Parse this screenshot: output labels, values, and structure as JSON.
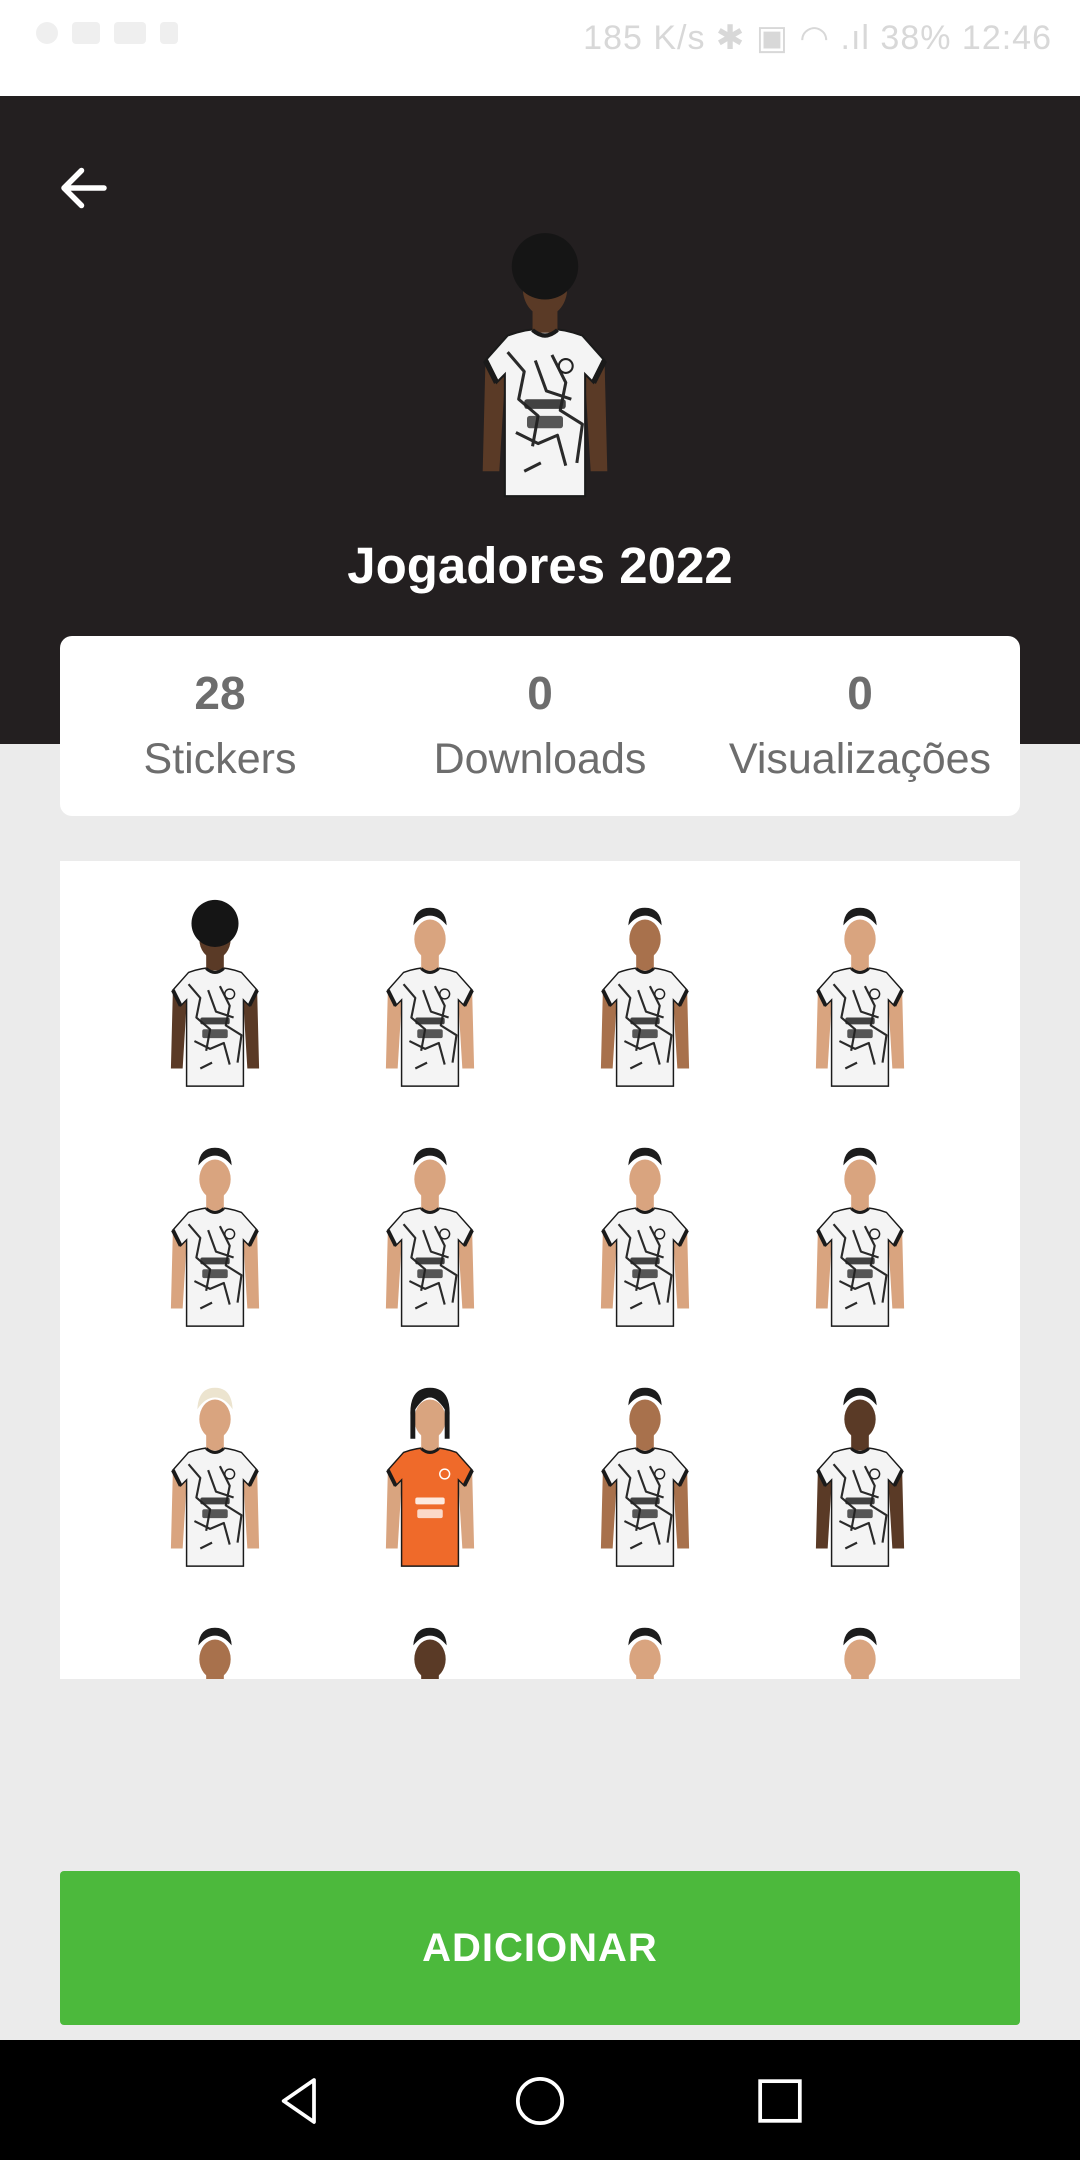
{
  "status_bar": {
    "right_text": "185 K/s ✱ ▣ ◠ .ıl 38% 12:46"
  },
  "header": {
    "title": "Jogadores 2022",
    "back_icon": "arrow-left-icon"
  },
  "stats": [
    {
      "value": "28",
      "label": "Stickers"
    },
    {
      "value": "0",
      "label": "Downloads"
    },
    {
      "value": "0",
      "label": "Visualizações"
    }
  ],
  "stickers": [
    {
      "jersey": "white",
      "hair": "afro",
      "skin": "dark"
    },
    {
      "jersey": "white",
      "hair": "short",
      "skin": "light"
    },
    {
      "jersey": "white",
      "hair": "short",
      "skin": "medium"
    },
    {
      "jersey": "white",
      "hair": "short",
      "skin": "light"
    },
    {
      "jersey": "white",
      "hair": "short",
      "skin": "light"
    },
    {
      "jersey": "white",
      "hair": "short",
      "skin": "light"
    },
    {
      "jersey": "white",
      "hair": "short",
      "skin": "light"
    },
    {
      "jersey": "white",
      "hair": "short",
      "skin": "light"
    },
    {
      "jersey": "white",
      "hair": "bleached",
      "skin": "light"
    },
    {
      "jersey": "orange",
      "hair": "long",
      "skin": "light"
    },
    {
      "jersey": "white",
      "hair": "short",
      "skin": "medium"
    },
    {
      "jersey": "white",
      "hair": "short",
      "skin": "dark"
    },
    {
      "jersey": "white",
      "hair": "short",
      "skin": "medium"
    },
    {
      "jersey": "white",
      "hair": "short",
      "skin": "dark"
    },
    {
      "jersey": "white",
      "hair": "short",
      "skin": "light"
    },
    {
      "jersey": "white",
      "hair": "short",
      "skin": "light"
    }
  ],
  "add_button": {
    "label": "ADICIONAR"
  },
  "colors": {
    "header_bg": "#231f20",
    "accent_green": "#4cb93c",
    "page_bg": "#ebebeb",
    "stat_text": "#6d6d6d",
    "jersey_orange": "#ef6a2a"
  },
  "nav": {
    "back": "triangle-back-icon",
    "home": "circle-home-icon",
    "recents": "square-recents-icon"
  }
}
